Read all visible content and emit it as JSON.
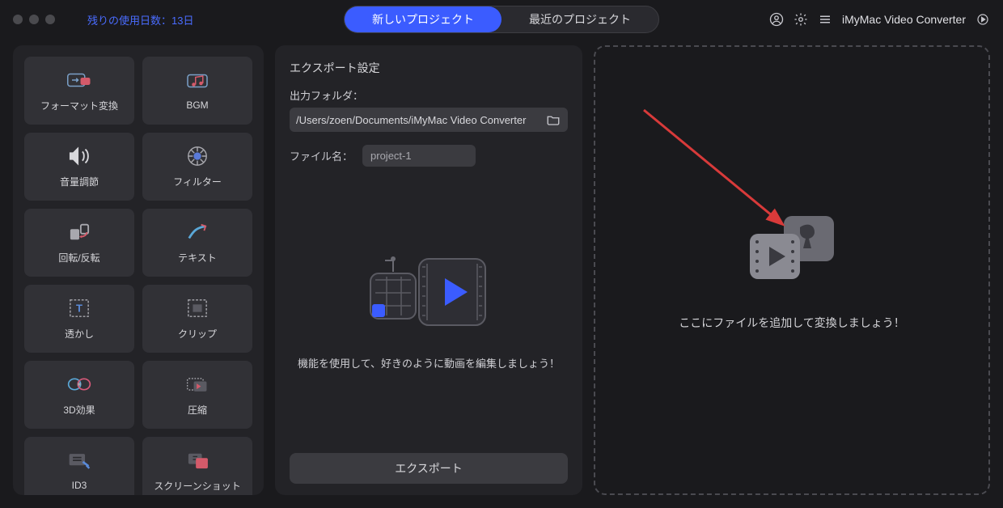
{
  "titlebar": {
    "trial_text": "残りの使用日数：13日",
    "app_name": "iMyMac Video Converter"
  },
  "tabs": {
    "new_project": "新しいプロジェクト",
    "recent_projects": "最近のプロジェクト"
  },
  "tools": [
    {
      "label": "フォーマット変換",
      "icon": "format-convert"
    },
    {
      "label": "BGM",
      "icon": "bgm"
    },
    {
      "label": "音量調節",
      "icon": "volume"
    },
    {
      "label": "フィルター",
      "icon": "filter"
    },
    {
      "label": "回転/反転",
      "icon": "rotate-flip"
    },
    {
      "label": "テキスト",
      "icon": "text"
    },
    {
      "label": "透かし",
      "icon": "watermark"
    },
    {
      "label": "クリップ",
      "icon": "clip"
    },
    {
      "label": "3D効果",
      "icon": "3d-effect"
    },
    {
      "label": "圧縮",
      "icon": "compress"
    },
    {
      "label": "ID3",
      "icon": "id3"
    },
    {
      "label": "スクリーンショット",
      "icon": "screenshot"
    }
  ],
  "export": {
    "section_title": "エクスポート設定",
    "folder_label": "出力フォルダ：",
    "folder_path": "/Users/zoen/Documents/iMyMac Video Converter",
    "filename_label": "ファイル名：",
    "filename_value": "project-1",
    "illustration_caption": "機能を使用して、好きのように動画を編集しましょう！",
    "export_button": "エクスポート"
  },
  "dropzone": {
    "text": "ここにファイルを追加して変換しましょう！"
  },
  "colors": {
    "accent": "#3b5cff",
    "arrow": "#d83a3a"
  }
}
